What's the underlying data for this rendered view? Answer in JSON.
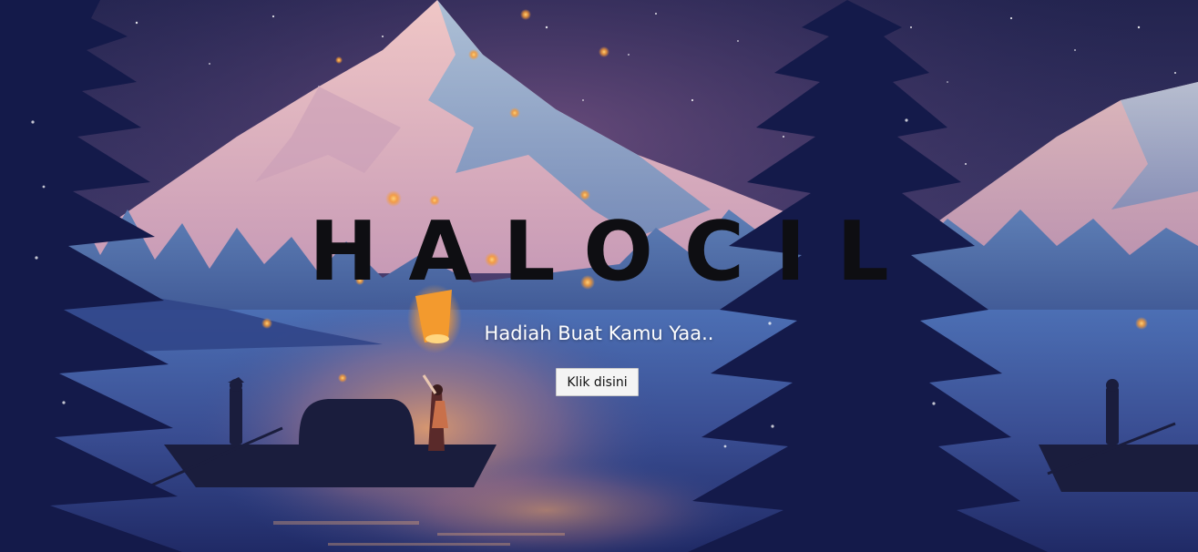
{
  "hero": {
    "title": "HALOCIL",
    "subtitle": "Hadiah Buat Kamu Yaa..",
    "button_label": "Klik disini"
  },
  "colors": {
    "sky_top": "#2a2a5c",
    "sky_glow": "#6e4a7a",
    "mountain_light": "#e4b5b8",
    "mountain_shade": "#8a9fc2",
    "lake": "#3b4f96",
    "tree_dark": "#141a4a",
    "lantern": "#f7a23a",
    "title_text": "#0e0e12",
    "subtitle_text": "#ffffff",
    "button_bg": "#f4f4f4"
  }
}
